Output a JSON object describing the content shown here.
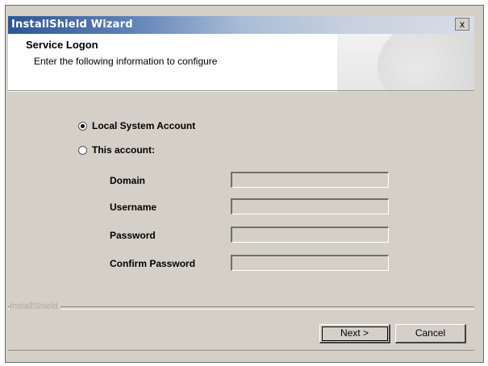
{
  "window": {
    "title": "InstallShield Wizard",
    "close_label": "x"
  },
  "header": {
    "title": "Service Logon",
    "subtitle": "Enter the following information to configure"
  },
  "options": {
    "local_system": {
      "label": "Local System Account",
      "selected": true
    },
    "this_account": {
      "label": "This account:",
      "selected": false
    }
  },
  "fields": {
    "domain": {
      "label": "Domain",
      "value": ""
    },
    "username": {
      "label": "Username",
      "value": ""
    },
    "password": {
      "label": "Password",
      "value": ""
    },
    "confirm_password": {
      "label": "Confirm Password",
      "value": ""
    }
  },
  "footer": {
    "brand": "InstallShield",
    "next_label": "Next >",
    "cancel_label": "Cancel"
  },
  "colors": {
    "dialog_bg": "#d4d0c8",
    "title_gradient_start": "#2f5596"
  }
}
